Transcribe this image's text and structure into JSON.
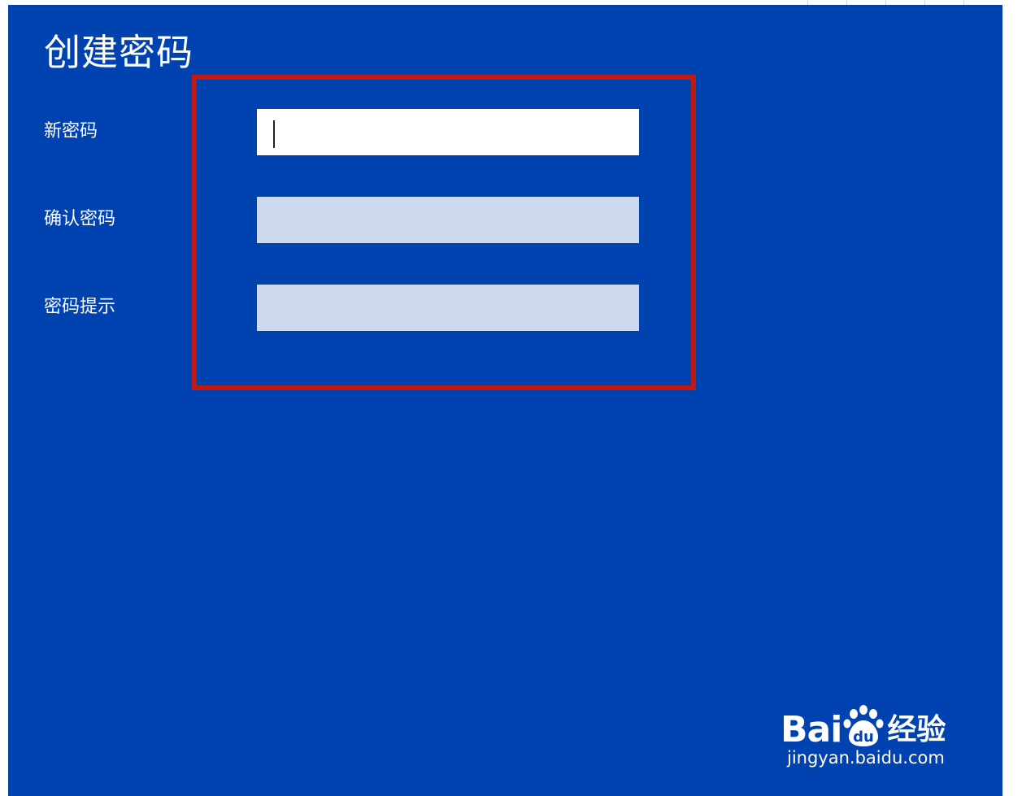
{
  "dialog": {
    "title": "创建密码",
    "fields": [
      {
        "label": "新密码",
        "value": "",
        "placeholder": "",
        "focused": true
      },
      {
        "label": "确认密码",
        "value": "",
        "placeholder": "",
        "focused": false
      },
      {
        "label": "密码提示",
        "value": "",
        "placeholder": "",
        "focused": false
      }
    ]
  },
  "watermark": {
    "brand_latin": "Bai",
    "brand_cn": "经验",
    "url": "jingyan.baidu.com"
  },
  "colors": {
    "background": "#0042b0",
    "input_active": "#ffffff",
    "input_inactive": "#ccd9ef",
    "highlight": "#c0190f",
    "text": "#ffffff"
  },
  "icons": {
    "paw": "baidu-paw-icon"
  }
}
